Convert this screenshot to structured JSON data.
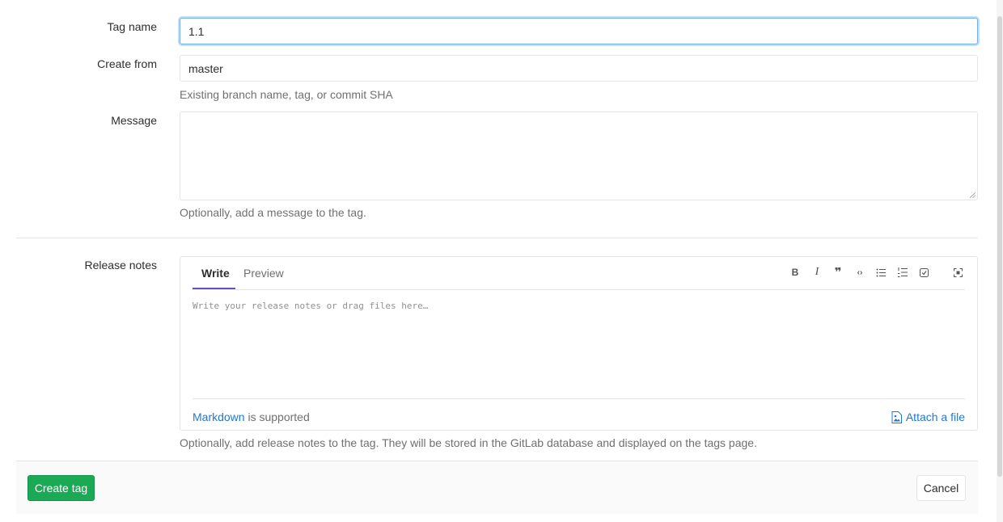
{
  "form": {
    "tag_name": {
      "label": "Tag name",
      "value": "1.1"
    },
    "create_from": {
      "label": "Create from",
      "value": "master",
      "help": "Existing branch name, tag, or commit SHA"
    },
    "message": {
      "label": "Message",
      "value": "",
      "help": "Optionally, add a message to the tag."
    },
    "release_notes": {
      "label": "Release notes",
      "tabs": [
        "Write",
        "Preview"
      ],
      "active_tab": "Write",
      "toolbar": [
        "bold-icon",
        "italic-icon",
        "quote-icon",
        "code-icon",
        "bullet-list-icon",
        "numbered-list-icon",
        "task-list-icon",
        "fullscreen-icon"
      ],
      "placeholder": "Write your release notes or drag files here…",
      "markdown_link": "Markdown",
      "markdown_suffix": " is supported",
      "attach_label": "Attach a file",
      "help": "Optionally, add release notes to the tag. They will be stored in the GitLab database and displayed on the tags page."
    }
  },
  "actions": {
    "create_label": "Create tag",
    "cancel_label": "Cancel"
  },
  "colors": {
    "accent": "#1f78d1",
    "create_button": "#1aaa55",
    "active_tab": "#6b4fbb"
  }
}
